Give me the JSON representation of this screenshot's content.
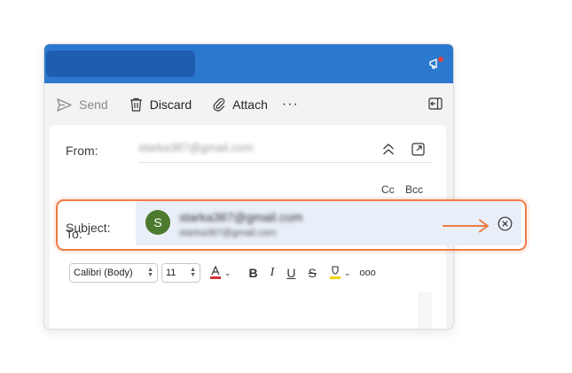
{
  "toolbar": {
    "send_label": "Send",
    "discard_label": "Discard",
    "attach_label": "Attach",
    "more_label": "···"
  },
  "compose": {
    "from_label": "From:",
    "from_value": "starka387@gmail.com",
    "to_label": "To:",
    "cc_label": "Cc",
    "bcc_label": "Bcc",
    "subject_label": "Subject:"
  },
  "suggestion": {
    "avatar_initial": "S",
    "name": "starka387@gmail.com",
    "email": "starka387@gmail.com",
    "avatar_color": "#4d7a2e"
  },
  "format": {
    "font_family": "Calibri (Body)",
    "font_size": "11",
    "bold_label": "B",
    "italic_label": "I",
    "underline_label": "U",
    "strike_label": "S",
    "more_label": "ooo"
  },
  "colors": {
    "titlebar": "#2b79cf",
    "highlight": "#ef7b45"
  },
  "icons": [
    "send-icon",
    "trash-icon",
    "paperclip-icon",
    "more-icon",
    "megaphone-icon",
    "sidebar-collapse-icon",
    "chevron-up-double-icon",
    "popout-icon",
    "close-circle-icon",
    "arrow-right-icon",
    "font-color-icon",
    "highlighter-icon"
  ]
}
